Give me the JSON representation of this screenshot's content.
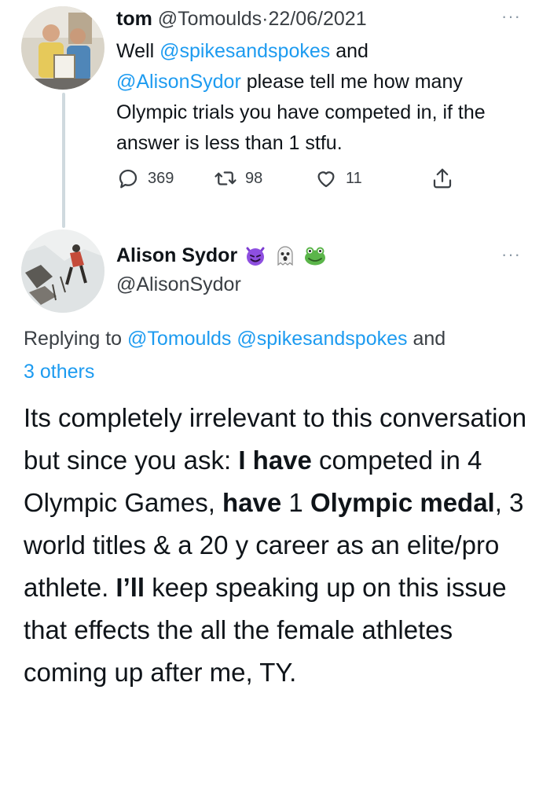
{
  "tweet1": {
    "author_name": "tom",
    "handle": "@Tomoulds",
    "separator": "·",
    "date": "22/06/2021",
    "text": {
      "p1": "Well ",
      "mention1": "@spikesandspokes",
      "p2": " and ",
      "mention2": "@AlisonSydor",
      "p3": " please tell me how many Olympic trials you have competed in, if the answer is less than 1 stfu."
    },
    "actions": {
      "reply_count": "369",
      "retweet_count": "98",
      "like_count": "11"
    },
    "more_icon": "···"
  },
  "tweet2": {
    "author_name": "Alison Sydor",
    "name_emojis": [
      "smiling-devil-emoji",
      "ghost-emoji",
      "frog-emoji"
    ],
    "handle": "@AlisonSydor",
    "more_icon": "···",
    "replying": {
      "prefix": "Replying to ",
      "m1": "@Tomoulds",
      "m2": "@spikesandspokes",
      "joiner": " and ",
      "others": "3 others"
    },
    "body": {
      "s1": "Its completely irrelevant to this conversation but since you ask: ",
      "b1": "I have",
      "s2": " competed in 4 Olympic Games, ",
      "b2": "have",
      "s3": " 1 ",
      "b3": "Olympic medal",
      "s4": ", 3 world titles & a 20 y career as an elite/pro athlete. ",
      "b4": "I’ll",
      "s5": " keep speaking up on this issue that effects the all the female athletes coming up after me, TY."
    }
  },
  "colors": {
    "link": "#1d9bf0",
    "secondary_text": "#3a3f44",
    "thread_line": "#cfd9de"
  }
}
